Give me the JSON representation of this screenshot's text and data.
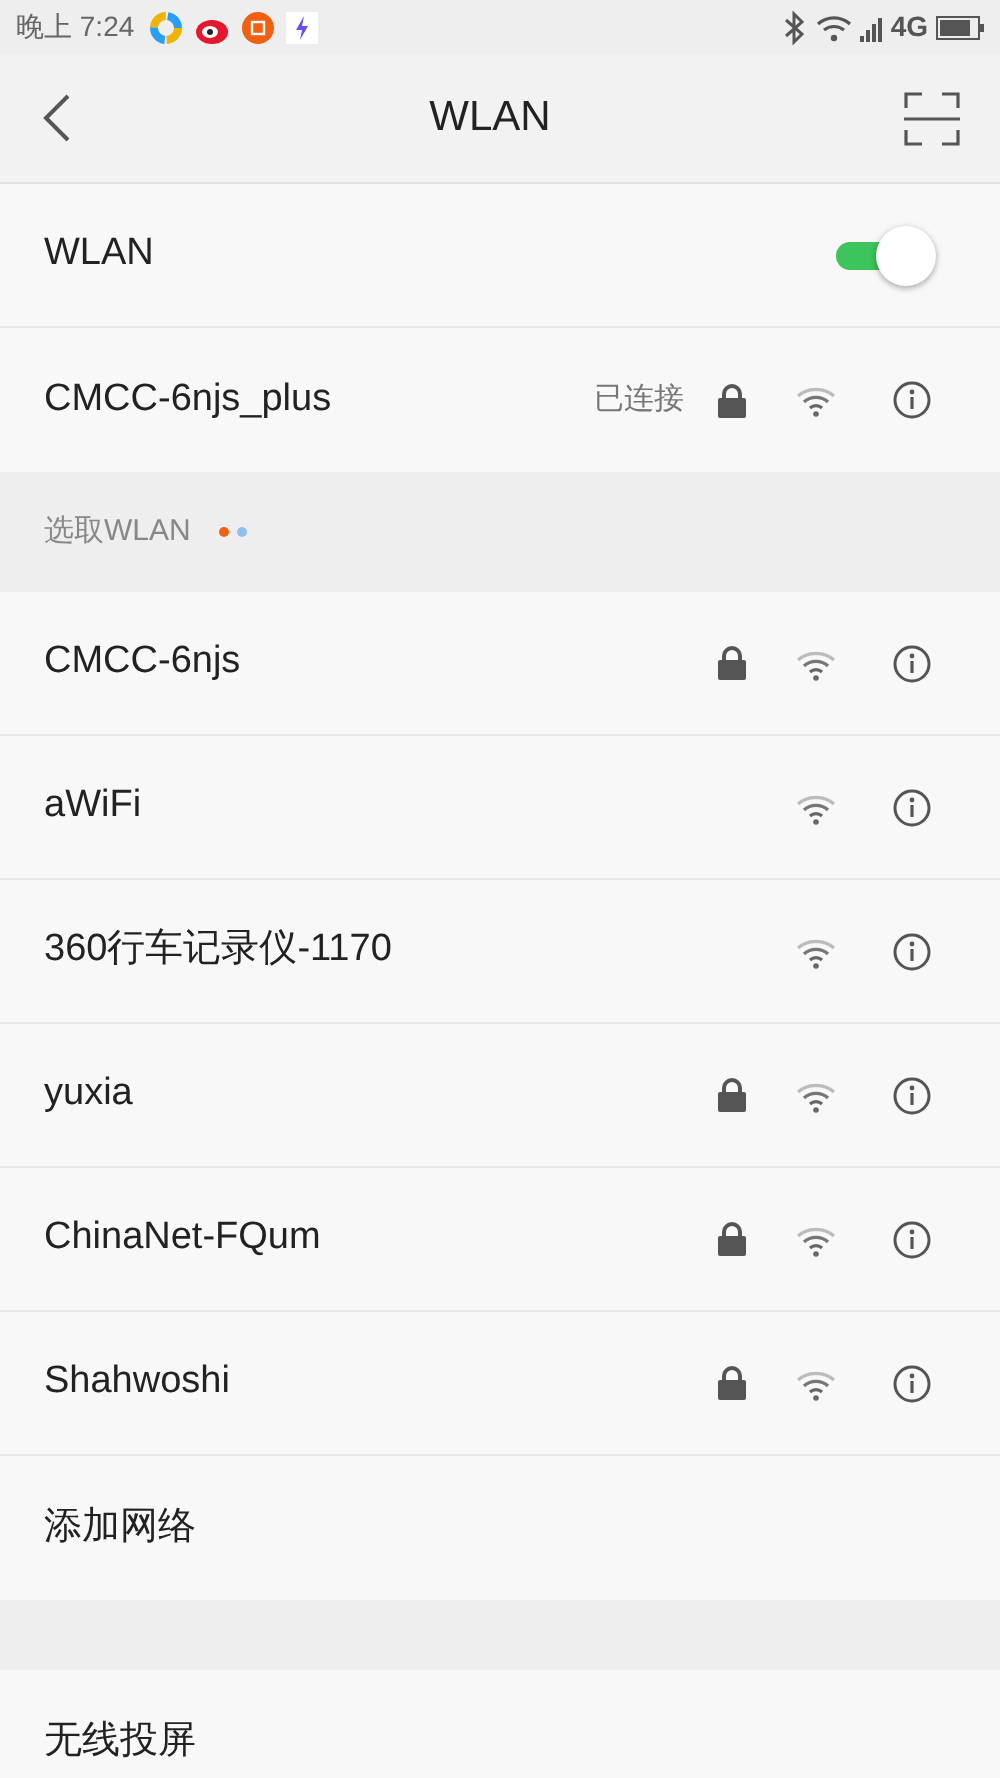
{
  "status_bar": {
    "time": "晚上 7:24",
    "network": "4G"
  },
  "header": {
    "title": "WLAN"
  },
  "wlan": {
    "label": "WLAN",
    "on": true
  },
  "connected": {
    "name": "CMCC-6njs_plus",
    "status": "已连接",
    "locked": true
  },
  "section": {
    "title": "选取WLAN"
  },
  "networks": [
    {
      "name": "CMCC-6njs",
      "locked": true
    },
    {
      "name": "aWiFi",
      "locked": false
    },
    {
      "name": "360行车记录仪-1170",
      "locked": false
    },
    {
      "name": "yuxia",
      "locked": true
    },
    {
      "name": "ChinaNet-FQum",
      "locked": true
    },
    {
      "name": "Shahwoshi",
      "locked": true
    }
  ],
  "add_network": "添加网络",
  "cast": "无线投屏"
}
